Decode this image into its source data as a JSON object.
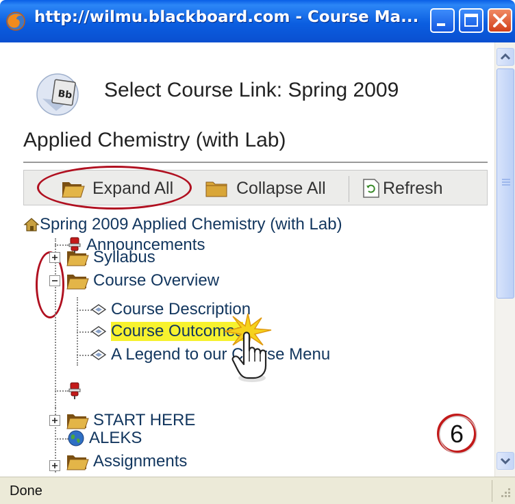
{
  "window": {
    "title": "http://wilmu.blackboard.com - Course Ma..."
  },
  "dialog": {
    "select_title": "Select Course Link: Spring 2009",
    "course_title": "Applied Chemistry (with Lab)",
    "logo_text": "Bb"
  },
  "toolbar": {
    "expand_all": "Expand All",
    "collapse_all": "Collapse All",
    "refresh": "Refresh"
  },
  "tree": {
    "root": "Spring 2009 Applied Chemistry (with Lab)",
    "items": [
      {
        "label": "Announcements",
        "icon": "pushpin-icon"
      },
      {
        "label": "Syllabus",
        "icon": "folder-icon",
        "expander": "+"
      },
      {
        "label": "Course Overview",
        "icon": "folder-icon",
        "expander": "-"
      },
      {
        "label": "Course Description",
        "icon": "link-diamond-icon"
      },
      {
        "label": "Course Outcomes",
        "icon": "link-diamond-icon",
        "highlighted": true
      },
      {
        "label": "A Legend to our Course Menu",
        "icon": "link-diamond-icon"
      },
      {
        "label": "",
        "icon": "pushpin-icon"
      },
      {
        "label": "START HERE",
        "icon": "folder-icon",
        "expander": "+"
      },
      {
        "label": "ALEKS",
        "icon": "globe-icon"
      },
      {
        "label": "Assignments",
        "icon": "folder-icon",
        "expander": "+"
      }
    ]
  },
  "annotation": {
    "step_number": "6"
  },
  "status": {
    "text": "Done"
  },
  "colors": {
    "titlebar": "#0b5ee0",
    "link_text": "#12365e",
    "highlight": "#f7f22e",
    "annotation_red": "#b01020"
  }
}
